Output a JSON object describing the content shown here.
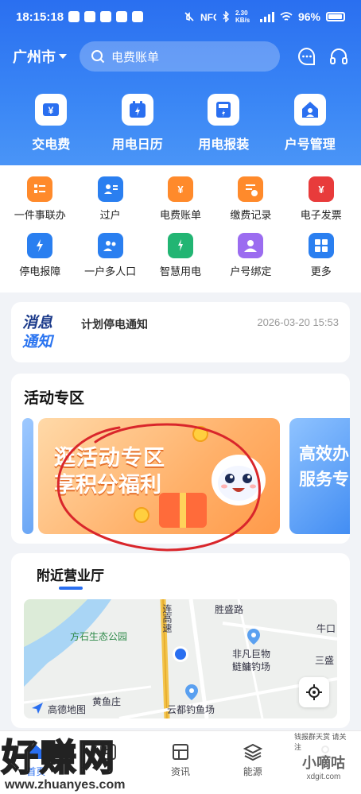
{
  "status": {
    "time": "18:15:18",
    "speed": "2.30 KB/s",
    "battery": "96%"
  },
  "header": {
    "city": "广州市",
    "search_placeholder": "电费账单"
  },
  "quick_actions": [
    {
      "label": "交电费",
      "icon": "yuan-icon"
    },
    {
      "label": "用电日历",
      "icon": "calendar-icon"
    },
    {
      "label": "用电报装",
      "icon": "meter-icon"
    },
    {
      "label": "户号管理",
      "icon": "house-icon"
    }
  ],
  "services": [
    {
      "label": "一件事联办",
      "icon": "checklist-icon",
      "color": "#ff8a2b"
    },
    {
      "label": "过户",
      "icon": "transfer-icon",
      "color": "#2a7ff0"
    },
    {
      "label": "电费账单",
      "icon": "bill-icon",
      "color": "#ff8a2b"
    },
    {
      "label": "缴费记录",
      "icon": "record-icon",
      "color": "#ff8a2b"
    },
    {
      "label": "电子发票",
      "icon": "invoice-icon",
      "color": "#e83b3b"
    },
    {
      "label": "停电报障",
      "icon": "repair-icon",
      "color": "#2a7ff0"
    },
    {
      "label": "一户多人口",
      "icon": "family-icon",
      "color": "#2a7ff0"
    },
    {
      "label": "智慧用电",
      "icon": "bulb-icon",
      "color": "#22b573"
    },
    {
      "label": "户号绑定",
      "icon": "user-bind-icon",
      "color": "#9b6cf0"
    },
    {
      "label": "更多",
      "icon": "grid-icon",
      "color": "#2a7ff0"
    }
  ],
  "notice": {
    "logo_line1": "消息",
    "logo_line2": "通知",
    "title": "计划停电通知",
    "time": "2026-03-20 15:53"
  },
  "activity": {
    "title": "活动专区",
    "banner_line1": "逛活动专区",
    "banner_line2": "享积分福利",
    "next_banner_line1": "高效办",
    "next_banner_line2": "服务专"
  },
  "nearby": {
    "title": "附近营业厅",
    "map_labels": [
      "方石生态公园",
      "连高速",
      "胜盛路",
      "非凡巨物",
      "鲢鳙钓场",
      "牛口",
      "三盛",
      "黄鱼庄",
      "云都钓鱼场",
      "高德地图"
    ]
  },
  "tabbar": [
    {
      "label": "首页",
      "icon": "home-icon"
    },
    {
      "label": "",
      "icon": "service-icon"
    },
    {
      "label": "资讯",
      "icon": "news-icon"
    },
    {
      "label": "能源",
      "icon": "layers-icon"
    },
    {
      "label": "",
      "icon": "profile-icon"
    }
  ],
  "watermark": {
    "brand": "好赚网",
    "url": "www.zhuanyes.com",
    "right_top": "钱报群天赏 请关注",
    "right_main": "小嘀咕",
    "right_url": "xdgit.com"
  },
  "colors": {
    "primary": "#2a6ff0",
    "accent_orange": "#ff8a2b",
    "scribble": "#d9262b"
  }
}
